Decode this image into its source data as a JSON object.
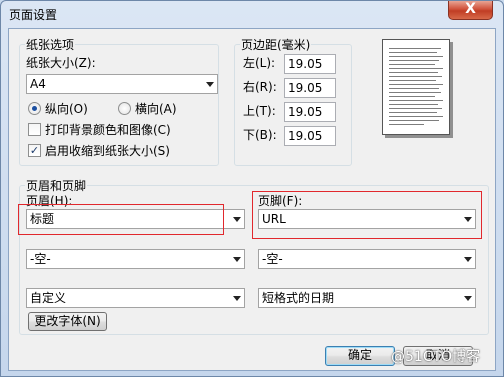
{
  "window": {
    "title": "页面设置",
    "close_label": "X"
  },
  "paper": {
    "group_label": "纸张选项",
    "size_label": "纸张大小(Z):",
    "size_value": "A4",
    "orientation": [
      {
        "label": "纵向(O)",
        "selected": true
      },
      {
        "label": "横向(A)",
        "selected": false
      }
    ],
    "print_background_label": "打印背景颜色和图像(C)",
    "print_background_checked": false,
    "shrink_to_fit_label": "启用收缩到纸张大小(S)",
    "shrink_to_fit_checked": true,
    "checkmark": "✓"
  },
  "margins": {
    "group_label": "页边距(毫米)",
    "left_label": "左(L):",
    "left_value": "19.05",
    "right_label": "右(R):",
    "right_value": "19.05",
    "top_label": "上(T):",
    "top_value": "19.05",
    "bottom_label": "下(B):",
    "bottom_value": "19.05"
  },
  "header_footer": {
    "group_label": "页眉和页脚",
    "header_label": "页眉(H):",
    "footer_label": "页脚(F):",
    "header_row1": "标题",
    "footer_row1": "URL",
    "header_row2": "-空-",
    "footer_row2": "-空-",
    "header_row3": "自定义",
    "footer_row3": "短格式的日期",
    "change_font_label": "更改字体(N)"
  },
  "buttons": {
    "ok_label": "确定",
    "cancel_label": "取消"
  },
  "watermark": "@51CTO博客",
  "highlight_color": "#e1282d"
}
